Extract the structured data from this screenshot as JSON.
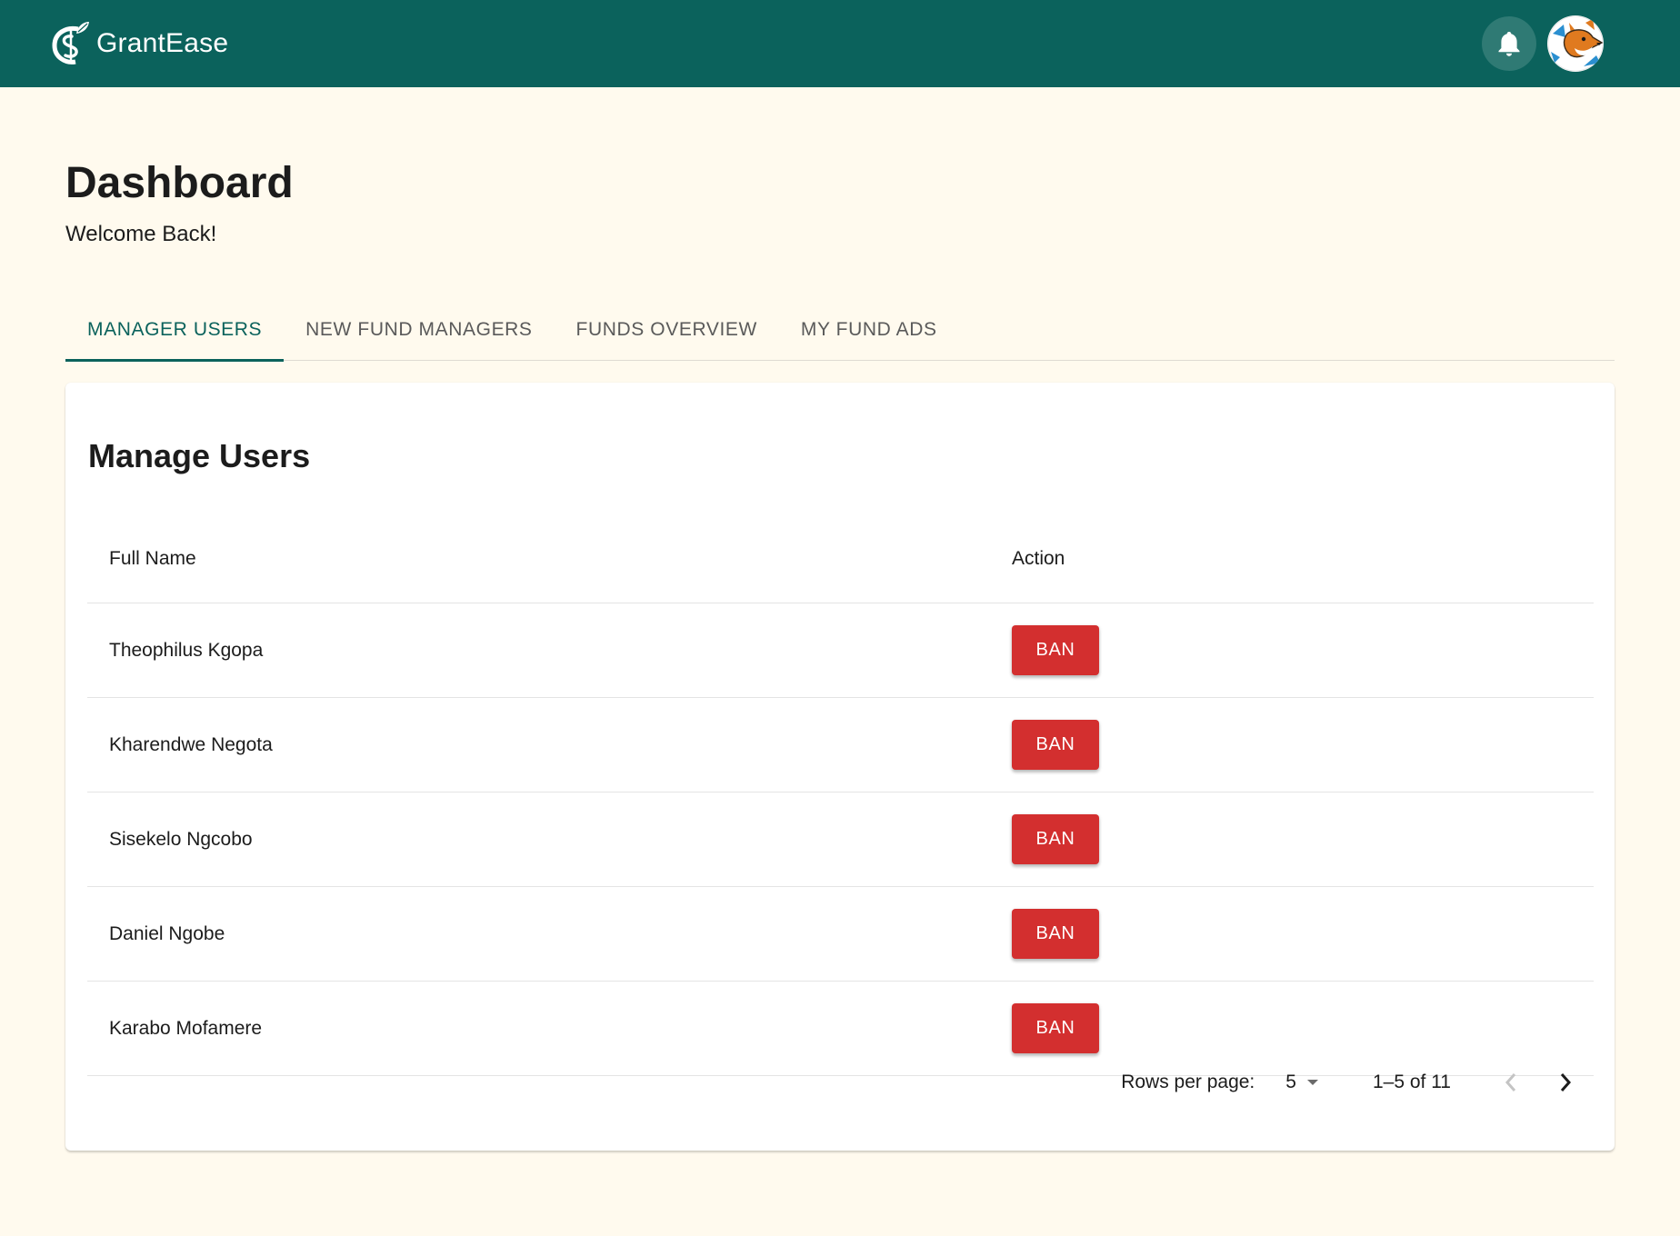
{
  "app": {
    "name": "GrantEase"
  },
  "header": {
    "title": "Dashboard",
    "subtitle": "Welcome Back!"
  },
  "tabs": [
    {
      "label": "MANAGER USERS",
      "active": true
    },
    {
      "label": "NEW FUND MANAGERS",
      "active": false
    },
    {
      "label": "FUNDS OVERVIEW",
      "active": false
    },
    {
      "label": "MY FUND ADS",
      "active": false
    }
  ],
  "card": {
    "title": "Manage Users",
    "columns": {
      "name": "Full Name",
      "action": "Action"
    },
    "rows": [
      {
        "name": "Theophilus Kgopa",
        "action": "BAN"
      },
      {
        "name": "Kharendwe Negota",
        "action": "BAN"
      },
      {
        "name": "Sisekelo Ngcobo",
        "action": "BAN"
      },
      {
        "name": "Daniel Ngobe",
        "action": "BAN"
      },
      {
        "name": "Karabo Mofamere",
        "action": "BAN"
      }
    ]
  },
  "pagination": {
    "rows_per_page_label": "Rows per page:",
    "rows_per_page": "5",
    "range": "1–5 of 11"
  },
  "icons": {
    "logo": "dollar-leaf-icon",
    "notifications": "bell-icon",
    "avatar": "fox-avatar",
    "dropdown": "caret-down-icon",
    "prev": "chevron-left-icon",
    "next": "chevron-right-icon"
  },
  "colors": {
    "appbar": "#0b625c",
    "background": "#fffaee",
    "accent": "#0b625c",
    "ban": "#d32f2f"
  }
}
